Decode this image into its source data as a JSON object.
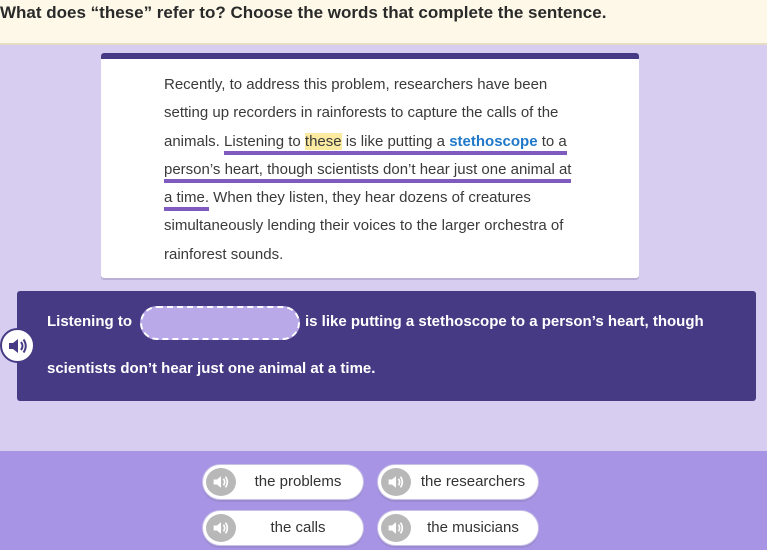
{
  "question": "What does “these” refer to? Choose the words that complete the sentence.",
  "passage": {
    "l1": "Recently, to address this problem, researchers have been",
    "l2": "setting up recorders in rainforests to capture the calls of the",
    "l3_a": "animals. ",
    "l3_b": "Listening to ",
    "l3_these": "these",
    "l3_c": " is like putting a ",
    "l3_vocab": "stethoscope",
    "l3_d": " to a",
    "l4": "person’s heart, though scientists don’t hear just one animal at",
    "l5_a": "a time.",
    "l5_b": " When they listen, they hear dozens of creatures",
    "l6": "simultaneously lending their voices to the larger orchestra of",
    "l7": "rainforest sounds."
  },
  "sentence": {
    "before": "Listening to",
    "after": "is like putting a stethoscope to a person’s heart, though",
    "line2": "scientists don’t hear just one animal at a time."
  },
  "choices": [
    {
      "label": "the problems"
    },
    {
      "label": "the researchers"
    },
    {
      "label": "the calls"
    },
    {
      "label": "the musicians"
    }
  ],
  "icons": {
    "audio": "speaker-icon"
  },
  "colors": {
    "panel": "#473a85",
    "background": "#d6cdf0",
    "choices_bg": "#a894e4",
    "highlight": "#fbeaa0",
    "vocab": "#1f78c8"
  }
}
